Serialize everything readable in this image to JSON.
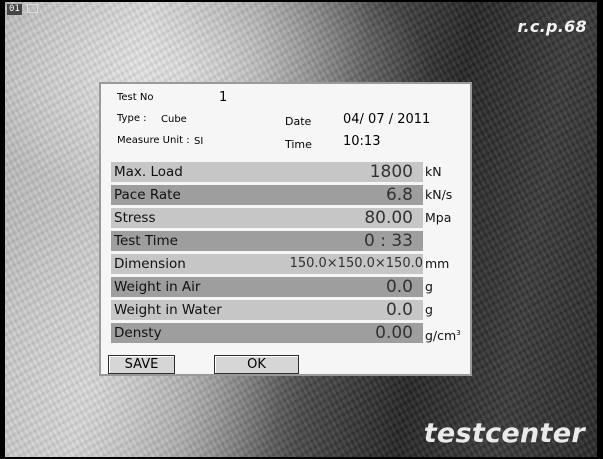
{
  "overlay": {
    "channel": "01"
  },
  "brand": {
    "top": "r.c.p.68",
    "bottom": "testcenter"
  },
  "header": {
    "test_no_label": "Test No",
    "test_no_value": "1",
    "type_label": "Type :",
    "type_value": "Cube",
    "measure_unit_label": "Measure Unit :",
    "measure_unit_value": "SI",
    "date_label": "Date",
    "date_value": "04/ 07 / 2011",
    "time_label": "Time",
    "time_value": "10:13"
  },
  "rows": [
    {
      "label": "Max. Load",
      "value": "1800",
      "unit": "kN"
    },
    {
      "label": "Pace Rate",
      "value": "6.8",
      "unit": "kN/s"
    },
    {
      "label": "Stress",
      "value": "80.00",
      "unit": "Mpa"
    },
    {
      "label": "Test Time",
      "value": "0 : 33",
      "unit": ""
    },
    {
      "label": "Dimension",
      "value": "150.0×150.0×150.0",
      "unit": "mm"
    },
    {
      "label": "Weight in Air",
      "value": "0.0",
      "unit": "g"
    },
    {
      "label": "Weight in Water",
      "value": "0.0",
      "unit": "g"
    },
    {
      "label": "Densty",
      "value": "0.00",
      "unit": "g/cm",
      "unit_sup": "3"
    }
  ],
  "buttons": {
    "save": "SAVE",
    "ok": "OK"
  }
}
